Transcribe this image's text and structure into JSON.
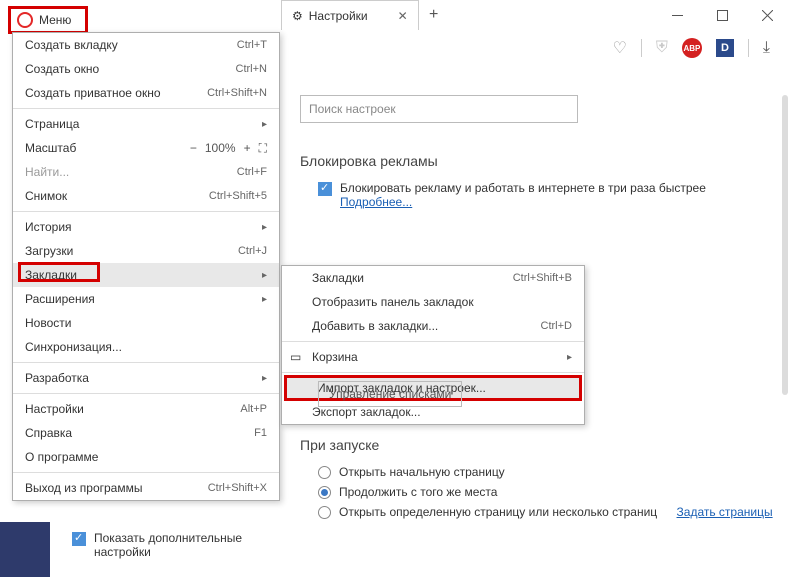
{
  "window": {
    "menu_button": "Меню"
  },
  "tab": {
    "title": "Настройки",
    "plus": "+"
  },
  "toolbar": {
    "abp": "ABP",
    "d": "D"
  },
  "menu": {
    "new_tab": "Создать вкладку",
    "new_tab_sc": "Ctrl+T",
    "new_window": "Создать окно",
    "new_window_sc": "Ctrl+N",
    "new_private": "Создать приватное окно",
    "new_private_sc": "Ctrl+Shift+N",
    "page": "Страница",
    "zoom": "Масштаб",
    "zoom_val": "100%",
    "find": "Найти...",
    "find_sc": "Ctrl+F",
    "snapshot": "Снимок",
    "snapshot_sc": "Ctrl+Shift+5",
    "history": "История",
    "downloads": "Загрузки",
    "downloads_sc": "Ctrl+J",
    "bookmarks": "Закладки",
    "extensions": "Расширения",
    "news": "Новости",
    "sync": "Синхронизация...",
    "dev": "Разработка",
    "settings": "Настройки",
    "settings_sc": "Alt+P",
    "help": "Справка",
    "help_sc": "F1",
    "about": "О программе",
    "exit": "Выход из программы",
    "exit_sc": "Ctrl+Shift+X"
  },
  "submenu": {
    "bookmarks": "Закладки",
    "bookmarks_sc": "Ctrl+Shift+B",
    "show_bar": "Отобразить панель закладок",
    "add": "Добавить в закладки...",
    "add_sc": "Ctrl+D",
    "trash": "Корзина",
    "import": "Импорт закладок и настроек...",
    "export": "Экспорт закладок..."
  },
  "content": {
    "search_placeholder": "Поиск настроек",
    "adblock_title": "Блокировка рекламы",
    "adblock_label": "Блокировать рекламу и работать в интернете в три раза быстрее",
    "adblock_more": "Подробнее...",
    "manage_lists": "Управление списками",
    "startup_title": "При запуске",
    "r1": "Открыть начальную страницу",
    "r2": "Продолжить с того же места",
    "r3": "Открыть определенную страницу или несколько страниц",
    "set_pages": "Задать страницы",
    "show_advanced": "Показать дополнительные настройки"
  }
}
